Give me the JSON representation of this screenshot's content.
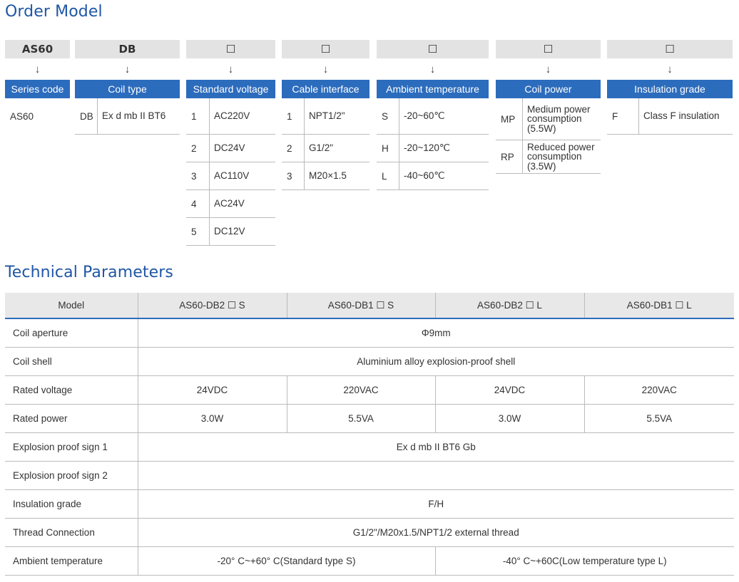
{
  "order_model": {
    "title": "Order Model",
    "arrow": "↓",
    "columns": [
      {
        "code": "AS60",
        "category": "Series code",
        "plain": true,
        "options": [
          {
            "key": "AS60",
            "value": ""
          }
        ]
      },
      {
        "code": "DB",
        "category": "Coil type",
        "options": [
          {
            "key": "DB",
            "value": "Ex d mb II BT6"
          }
        ]
      },
      {
        "code": "☐",
        "category": "Standard voltage",
        "options": [
          {
            "key": "1",
            "value": "AC220V"
          },
          {
            "key": "2",
            "value": "DC24V"
          },
          {
            "key": "3",
            "value": "AC110V"
          },
          {
            "key": "4",
            "value": "AC24V"
          },
          {
            "key": "5",
            "value": "DC12V"
          }
        ]
      },
      {
        "code": "☐",
        "category": "Cable interface",
        "options": [
          {
            "key": "1",
            "value": "NPT1/2\""
          },
          {
            "key": "2",
            "value": "G1/2\""
          },
          {
            "key": "3",
            "value": "M20×1.5"
          }
        ]
      },
      {
        "code": "☐",
        "category": "Ambient temperature",
        "options": [
          {
            "key": "S",
            "value": "-20~60℃"
          },
          {
            "key": "H",
            "value": "-20~120℃"
          },
          {
            "key": "L",
            "value": "-40~60℃"
          }
        ]
      },
      {
        "code": "☐",
        "category": "Coil power",
        "options": [
          {
            "key": "MP",
            "value": "Medium power consumption (5.5W)"
          },
          {
            "key": "RP",
            "value": "Reduced power consumption (3.5W)"
          }
        ]
      },
      {
        "code": "☐",
        "category": "Insulation grade",
        "options": [
          {
            "key": "F",
            "value": "Class F insulation"
          }
        ]
      }
    ]
  },
  "technical_parameters": {
    "title": "Technical Parameters",
    "headers": [
      "Model",
      "AS60-DB2 ☐ S",
      "AS60-DB1 ☐ S",
      "AS60-DB2 ☐ L",
      "AS60-DB1 ☐ L"
    ],
    "rows": [
      {
        "label": "Coil aperture",
        "cells": [
          {
            "text": "Φ9mm",
            "span": 4
          }
        ]
      },
      {
        "label": "Coil shell",
        "cells": [
          {
            "text": "Aluminium alloy explosion-proof shell",
            "span": 4
          }
        ]
      },
      {
        "label": "Rated voltage",
        "cells": [
          {
            "text": "24VDC",
            "span": 1
          },
          {
            "text": "220VAC",
            "span": 1
          },
          {
            "text": "24VDC",
            "span": 1
          },
          {
            "text": "220VAC",
            "span": 1
          }
        ]
      },
      {
        "label": "Rated power",
        "cells": [
          {
            "text": "3.0W",
            "span": 1
          },
          {
            "text": "5.5VA",
            "span": 1
          },
          {
            "text": "3.0W",
            "span": 1
          },
          {
            "text": "5.5VA",
            "span": 1
          }
        ]
      },
      {
        "label": "Explosion proof sign 1",
        "cells": [
          {
            "text": "Ex d mb II BT6 Gb",
            "span": 4
          }
        ]
      },
      {
        "label": "Explosion proof sign 2",
        "cells": [
          {
            "text": "",
            "span": 4
          }
        ]
      },
      {
        "label": "Insulation grade",
        "cells": [
          {
            "text": "F/H",
            "span": 4
          }
        ]
      },
      {
        "label": "Thread Connection",
        "cells": [
          {
            "text": "G1/2\"/M20x1.5/NPT1/2 external thread",
            "span": 4
          }
        ]
      },
      {
        "label": "Ambient temperature",
        "cells": [
          {
            "text": "-20° C~+60° C(Standard type S)",
            "span": 2
          },
          {
            "text": "-40° C~+60C(Low temperature type L)",
            "span": 2
          }
        ]
      }
    ]
  }
}
